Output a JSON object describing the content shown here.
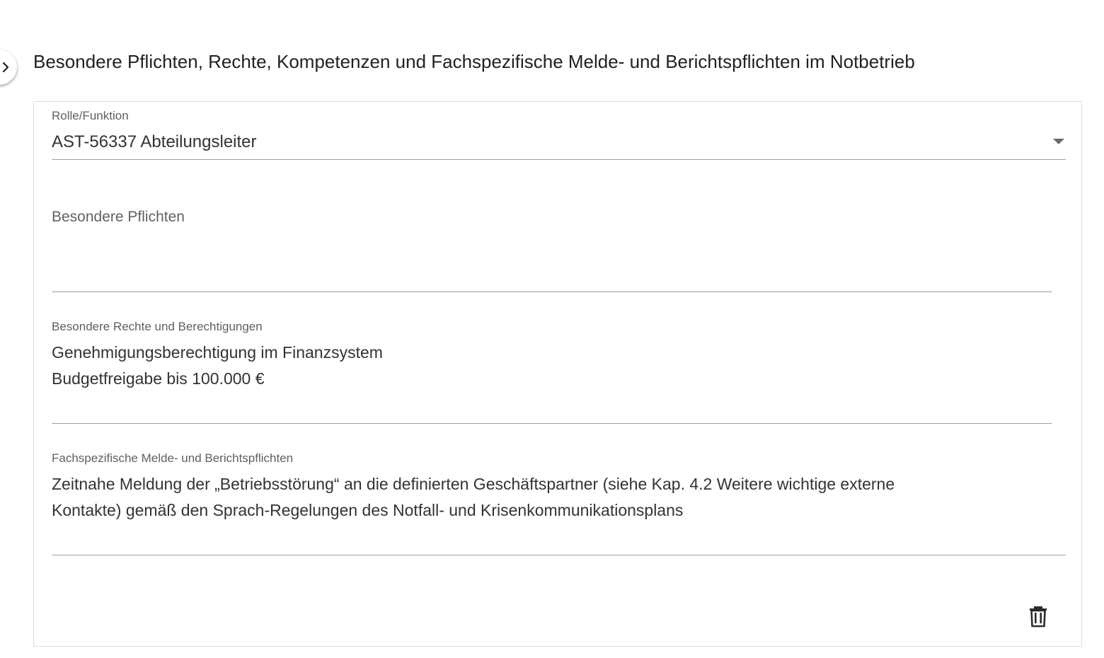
{
  "sidebar_toggle": {
    "icon": "chevron-right-icon"
  },
  "section": {
    "title": "Besondere Pflichten, Rechte, Kompetenzen und Fachspezifische Melde- und Berichtspflichten im Notbetrieb"
  },
  "form": {
    "role": {
      "label": "Rolle/Funktion",
      "value": "AST-56337 Abteilungsleiter",
      "icon": "dropdown-arrow-icon"
    },
    "duties": {
      "label": "Besondere Pflichten",
      "value": ""
    },
    "rights": {
      "label": "Besondere Rechte und Berechtigungen",
      "value": "Genehmigungsberechtigung im Finanzsystem\nBudgetfreigabe bis 100.000 €"
    },
    "reporting": {
      "label": "Fachspezifische Melde- und Berichtspflichten",
      "value": "Zeitnahe Meldung der „Betriebsstörung“ an die definierten Geschäftspartner (siehe Kap. 4.2 Weitere wichtige externe\nKontakte) gemäß den Sprach-Regelungen des Notfall- und Krisenkommunikationsplans"
    },
    "delete": {
      "icon": "trash-icon"
    }
  },
  "colors": {
    "text": "#212121",
    "label": "#5f5f5f",
    "underline": "#9e9e9e",
    "border": "#dcdcdc"
  }
}
